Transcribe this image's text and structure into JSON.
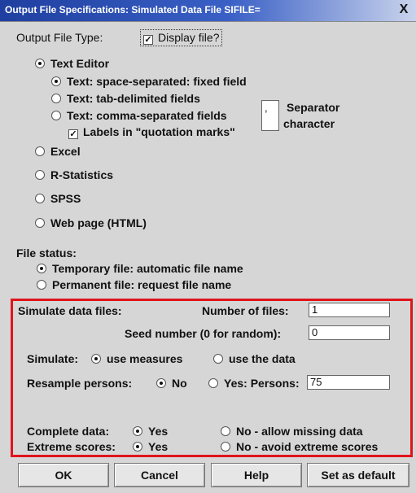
{
  "window": {
    "title": "Output File Specifications: Simulated Data File SIFILE=",
    "close_symbol": "X"
  },
  "output_type": {
    "label": "Output File Type:",
    "display_file_label": "Display file?",
    "display_file_checked": true
  },
  "text_editor": {
    "label": "Text Editor",
    "options": [
      "Text: space-separated: fixed field",
      "Text: tab-delimited fields",
      "Text: comma-separated fields"
    ],
    "labels_in_quotes": "Labels in \"quotation marks\"",
    "separator_value": ",",
    "separator_label_1": "Separator",
    "separator_label_2": "character"
  },
  "file_types": [
    "Excel",
    "R-Statistics",
    "SPSS",
    "Web page (HTML)"
  ],
  "file_status": {
    "label": "File status:",
    "temporary": "Temporary file: automatic file name",
    "permanent": "Permanent file: request file name"
  },
  "simulate": {
    "section_label": "Simulate data files:",
    "num_files_label": "Number of files:",
    "num_files_value": "1",
    "seed_label": "Seed number (0 for random):",
    "seed_value": "0",
    "simulate_label": "Simulate:",
    "use_measures": "use measures",
    "use_data": "use the data",
    "resample_label": "Resample persons:",
    "resample_no": "No",
    "resample_yes": "Yes: Persons:",
    "persons_value": "75",
    "complete_label": "Complete data:",
    "complete_yes": "Yes",
    "complete_no": "No - allow missing data",
    "extreme_label": "Extreme scores:",
    "extreme_yes": "Yes",
    "extreme_no": "No - avoid extreme scores"
  },
  "buttons": {
    "ok": "OK",
    "cancel": "Cancel",
    "help": "Help",
    "default": "Set as default"
  }
}
